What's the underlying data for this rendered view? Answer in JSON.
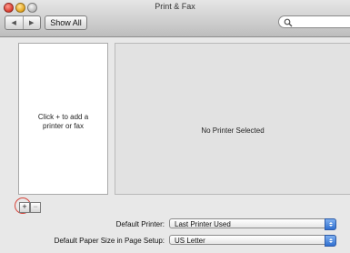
{
  "window": {
    "title": "Print & Fax"
  },
  "toolbar": {
    "back_icon": "back-arrow-icon",
    "forward_icon": "forward-arrow-icon",
    "show_all_label": "Show All",
    "search_placeholder": "",
    "search_icon": "magnifier-icon"
  },
  "printer_list": {
    "empty_message_line1": "Click + to add a",
    "empty_message_line2": "printer or fax"
  },
  "detail": {
    "message": "No Printer Selected"
  },
  "list_controls": {
    "add_label": "+",
    "remove_label": "−"
  },
  "settings": {
    "default_printer_label": "Default Printer:",
    "default_printer_value": "Last Printer Used",
    "paper_size_label": "Default Paper Size in Page Setup:",
    "paper_size_value": "US Letter"
  },
  "colors": {
    "highlight_ring": "#d6453b",
    "popup_arrow_blue": "#2f6fd0"
  }
}
